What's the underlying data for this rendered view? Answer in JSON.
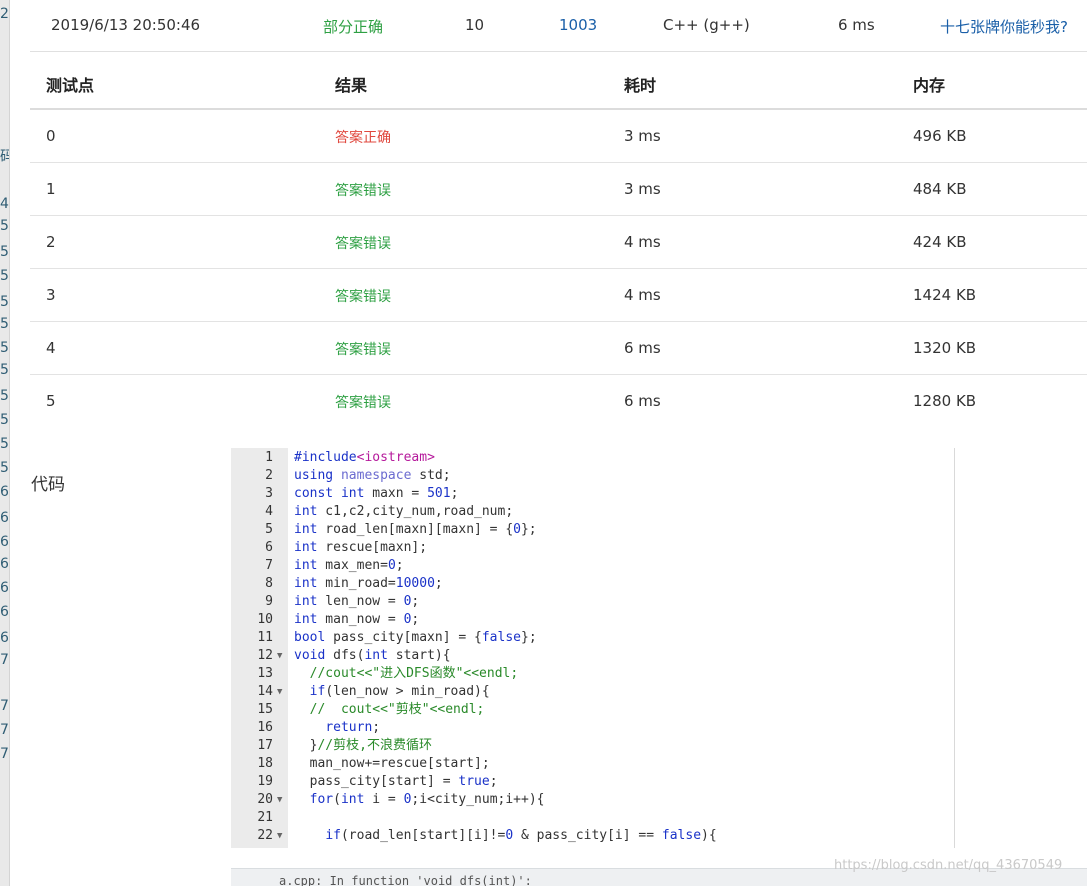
{
  "left_strip_chars": [
    "2",
    "码",
    "4",
    "5",
    "5",
    "5",
    "5",
    "5",
    "5",
    "5",
    "5",
    "5",
    "5",
    "5",
    "6",
    "6",
    "6",
    "6",
    "6",
    "6",
    "6",
    "7",
    "7",
    "7",
    "7"
  ],
  "summary": {
    "submit_time": "2019/6/13 20:50:46",
    "status": "部分正确",
    "score": "10",
    "problem": "1003",
    "language": "C++ (g++)",
    "runtime": "6 ms",
    "user": "十七张牌你能秒我?"
  },
  "colors": {
    "status_partial": "#2ea043",
    "answer_correct": "#e0473d",
    "answer_wrong": "#2ea043",
    "link": "#1a5fa8"
  },
  "table": {
    "headers": [
      "测试点",
      "结果",
      "耗时",
      "内存"
    ],
    "rows": [
      {
        "case": "0",
        "result": "答案正确",
        "kind": "ok",
        "time": "3 ms",
        "memory": "496 KB"
      },
      {
        "case": "1",
        "result": "答案错误",
        "kind": "wa",
        "time": "3 ms",
        "memory": "484 KB"
      },
      {
        "case": "2",
        "result": "答案错误",
        "kind": "wa",
        "time": "4 ms",
        "memory": "424 KB"
      },
      {
        "case": "3",
        "result": "答案错误",
        "kind": "wa",
        "time": "4 ms",
        "memory": "1424 KB"
      },
      {
        "case": "4",
        "result": "答案错误",
        "kind": "wa",
        "time": "6 ms",
        "memory": "1320 KB"
      },
      {
        "case": "5",
        "result": "答案错误",
        "kind": "wa",
        "time": "6 ms",
        "memory": "1280 KB"
      }
    ]
  },
  "code": {
    "label": "代码",
    "lines": [
      {
        "n": "1",
        "fold": false,
        "text": "#include<iostream>"
      },
      {
        "n": "2",
        "fold": false,
        "text": "using namespace std;"
      },
      {
        "n": "3",
        "fold": false,
        "text": "const int maxn = 501;"
      },
      {
        "n": "4",
        "fold": false,
        "text": "int c1,c2,city_num,road_num;"
      },
      {
        "n": "5",
        "fold": false,
        "text": "int road_len[maxn][maxn] = {0};"
      },
      {
        "n": "6",
        "fold": false,
        "text": "int rescue[maxn];"
      },
      {
        "n": "7",
        "fold": false,
        "text": "int max_men=0;"
      },
      {
        "n": "8",
        "fold": false,
        "text": "int min_road=10000;"
      },
      {
        "n": "9",
        "fold": false,
        "text": "int len_now = 0;"
      },
      {
        "n": "10",
        "fold": false,
        "text": "int man_now = 0;"
      },
      {
        "n": "11",
        "fold": false,
        "text": "bool pass_city[maxn] = {false};"
      },
      {
        "n": "12",
        "fold": true,
        "text": "void dfs(int start){"
      },
      {
        "n": "13",
        "fold": false,
        "text": "  //cout<<\"进入DFS函数\"<<endl;"
      },
      {
        "n": "14",
        "fold": true,
        "text": "  if(len_now > min_road){"
      },
      {
        "n": "15",
        "fold": false,
        "text": "  //  cout<<\"剪枝\"<<endl;"
      },
      {
        "n": "16",
        "fold": false,
        "text": "    return;"
      },
      {
        "n": "17",
        "fold": false,
        "text": "  }//剪枝,不浪费循环"
      },
      {
        "n": "18",
        "fold": false,
        "text": "  man_now+=rescue[start];"
      },
      {
        "n": "19",
        "fold": false,
        "text": "  pass_city[start] = true;"
      },
      {
        "n": "20",
        "fold": true,
        "text": "  for(int i = 0;i<city_num;i++){"
      },
      {
        "n": "21",
        "fold": false,
        "text": ""
      },
      {
        "n": "22",
        "fold": true,
        "text": "    if(road_len[start][i]!=0 & pass_city[i] == false){"
      }
    ]
  },
  "bottom_bar_text": "a.cpp: In function 'void dfs(int)':",
  "watermark": "https://blog.csdn.net/qq_43670549"
}
